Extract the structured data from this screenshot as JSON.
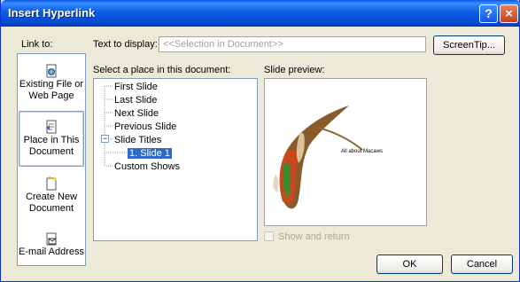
{
  "window": {
    "title": "Insert Hyperlink",
    "help": "?",
    "close": "×"
  },
  "top": {
    "link_to_label": "Link to:",
    "text_display_label": "Text to display:",
    "text_display_value": "<<Selection in Document>>",
    "screentip_button": "ScreenTip..."
  },
  "link_bar": {
    "items": [
      {
        "line1": "Existing File or",
        "line2": "Web Page",
        "icon": "globe-document-icon",
        "selected": false
      },
      {
        "line1": "Place in This",
        "line2": "Document",
        "icon": "document-place-icon",
        "selected": true
      },
      {
        "line1": "Create New",
        "line2": "Document",
        "icon": "new-document-icon",
        "selected": false
      },
      {
        "line1": "E-mail Address",
        "line2": "",
        "icon": "email-icon",
        "selected": false
      }
    ]
  },
  "place": {
    "label": "Select a place in this document:",
    "tree": [
      "First Slide",
      "Last Slide",
      "Next Slide",
      "Previous Slide",
      "Slide Titles",
      "1. Slide 1",
      "Custom Shows"
    ],
    "expander": "−",
    "selected": "1. Slide 1"
  },
  "preview": {
    "label": "Slide preview:",
    "slide_text": "All about Macaws",
    "show_and_return": "Show and return"
  },
  "buttons": {
    "ok": "OK",
    "cancel": "Cancel"
  },
  "colors": {
    "titlebar": "#0a58e6",
    "selection": "#316ac5",
    "face": "#ece9d8"
  }
}
